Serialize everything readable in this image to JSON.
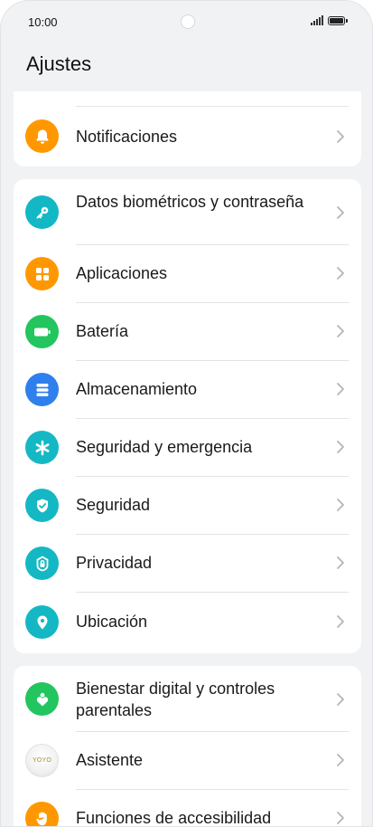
{
  "status": {
    "time": "10:00"
  },
  "page_title": "Ajustes",
  "group1": [
    {
      "label": "Notificaciones",
      "icon": "bell-icon",
      "color": "#FF9800"
    }
  ],
  "group2": [
    {
      "label": "Datos biométricos y contraseña",
      "icon": "key-icon",
      "color": "#14B8C4"
    },
    {
      "label": "Aplicaciones",
      "icon": "apps-grid-icon",
      "color": "#FF9800"
    },
    {
      "label": "Batería",
      "icon": "battery-icon",
      "color": "#22C55E"
    },
    {
      "label": "Almacenamiento",
      "icon": "storage-icon",
      "color": "#2F80ED"
    },
    {
      "label": "Seguridad y emergencia",
      "icon": "asterisk-icon",
      "color": "#14B8C4"
    },
    {
      "label": "Seguridad",
      "icon": "shield-check-icon",
      "color": "#14B8C4"
    },
    {
      "label": "Privacidad",
      "icon": "privacy-lock-icon",
      "color": "#14B8C4"
    },
    {
      "label": "Ubicación",
      "icon": "location-pin-icon",
      "color": "#14B8C4"
    }
  ],
  "group3": [
    {
      "label": "Bienestar digital y controles parentales",
      "icon": "wellbeing-heart-icon",
      "color": "#22C55E"
    },
    {
      "label": "Asistente",
      "icon": "yoyo-assistant-icon",
      "icon_text": "YOYO",
      "color": "#F3F3F3"
    },
    {
      "label": "Funciones de accesibilidad",
      "icon": "hand-icon",
      "color": "#FF9800"
    }
  ]
}
